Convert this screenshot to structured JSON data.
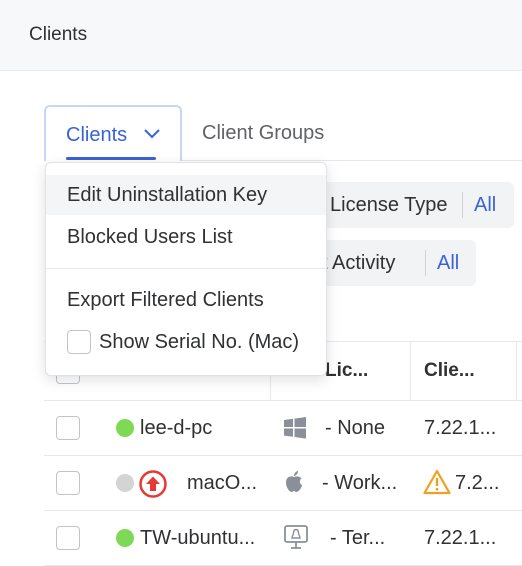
{
  "header": {
    "title": "Clients"
  },
  "tabs": [
    {
      "label": "Clients",
      "active": true
    },
    {
      "label": "Client Groups",
      "active": false
    }
  ],
  "filters": [
    {
      "label": "License Type",
      "value": "All"
    },
    {
      "label": "st Activity",
      "value": "All"
    }
  ],
  "dropdown_menu": {
    "items": [
      {
        "label": "Edit Uninstallation Key",
        "highlighted": true
      },
      {
        "label": "Blocked Users List"
      },
      {
        "label": "Export Filtered Clients"
      },
      {
        "label": "Show Serial No. (Mac)",
        "type": "checkbox",
        "checked": false
      }
    ]
  },
  "table": {
    "columns": [
      "Lic...",
      "Clie..."
    ],
    "rows": [
      {
        "name": "lee-d-pc",
        "status": "online",
        "os_icon": "windows-icon",
        "license": "- None",
        "client_version": "7.22.1...",
        "warning": false
      },
      {
        "name": "macO...",
        "status": "offline",
        "upgrade_icon": "upgrade-arrow-icon",
        "os_icon": "apple-icon",
        "license": "- Work...",
        "client_version": "7.2...",
        "warning": true
      },
      {
        "name": "TW-ubuntu...",
        "status": "online",
        "os_icon": "linux-icon",
        "license": "- Ter...",
        "client_version": "7.22.1...",
        "warning": false
      }
    ]
  },
  "colors": {
    "accent": "#3a62d8",
    "online": "#7ed957",
    "offline": "#d4d4d4",
    "upgrade": "#e53935",
    "warning": "#f0a020"
  }
}
